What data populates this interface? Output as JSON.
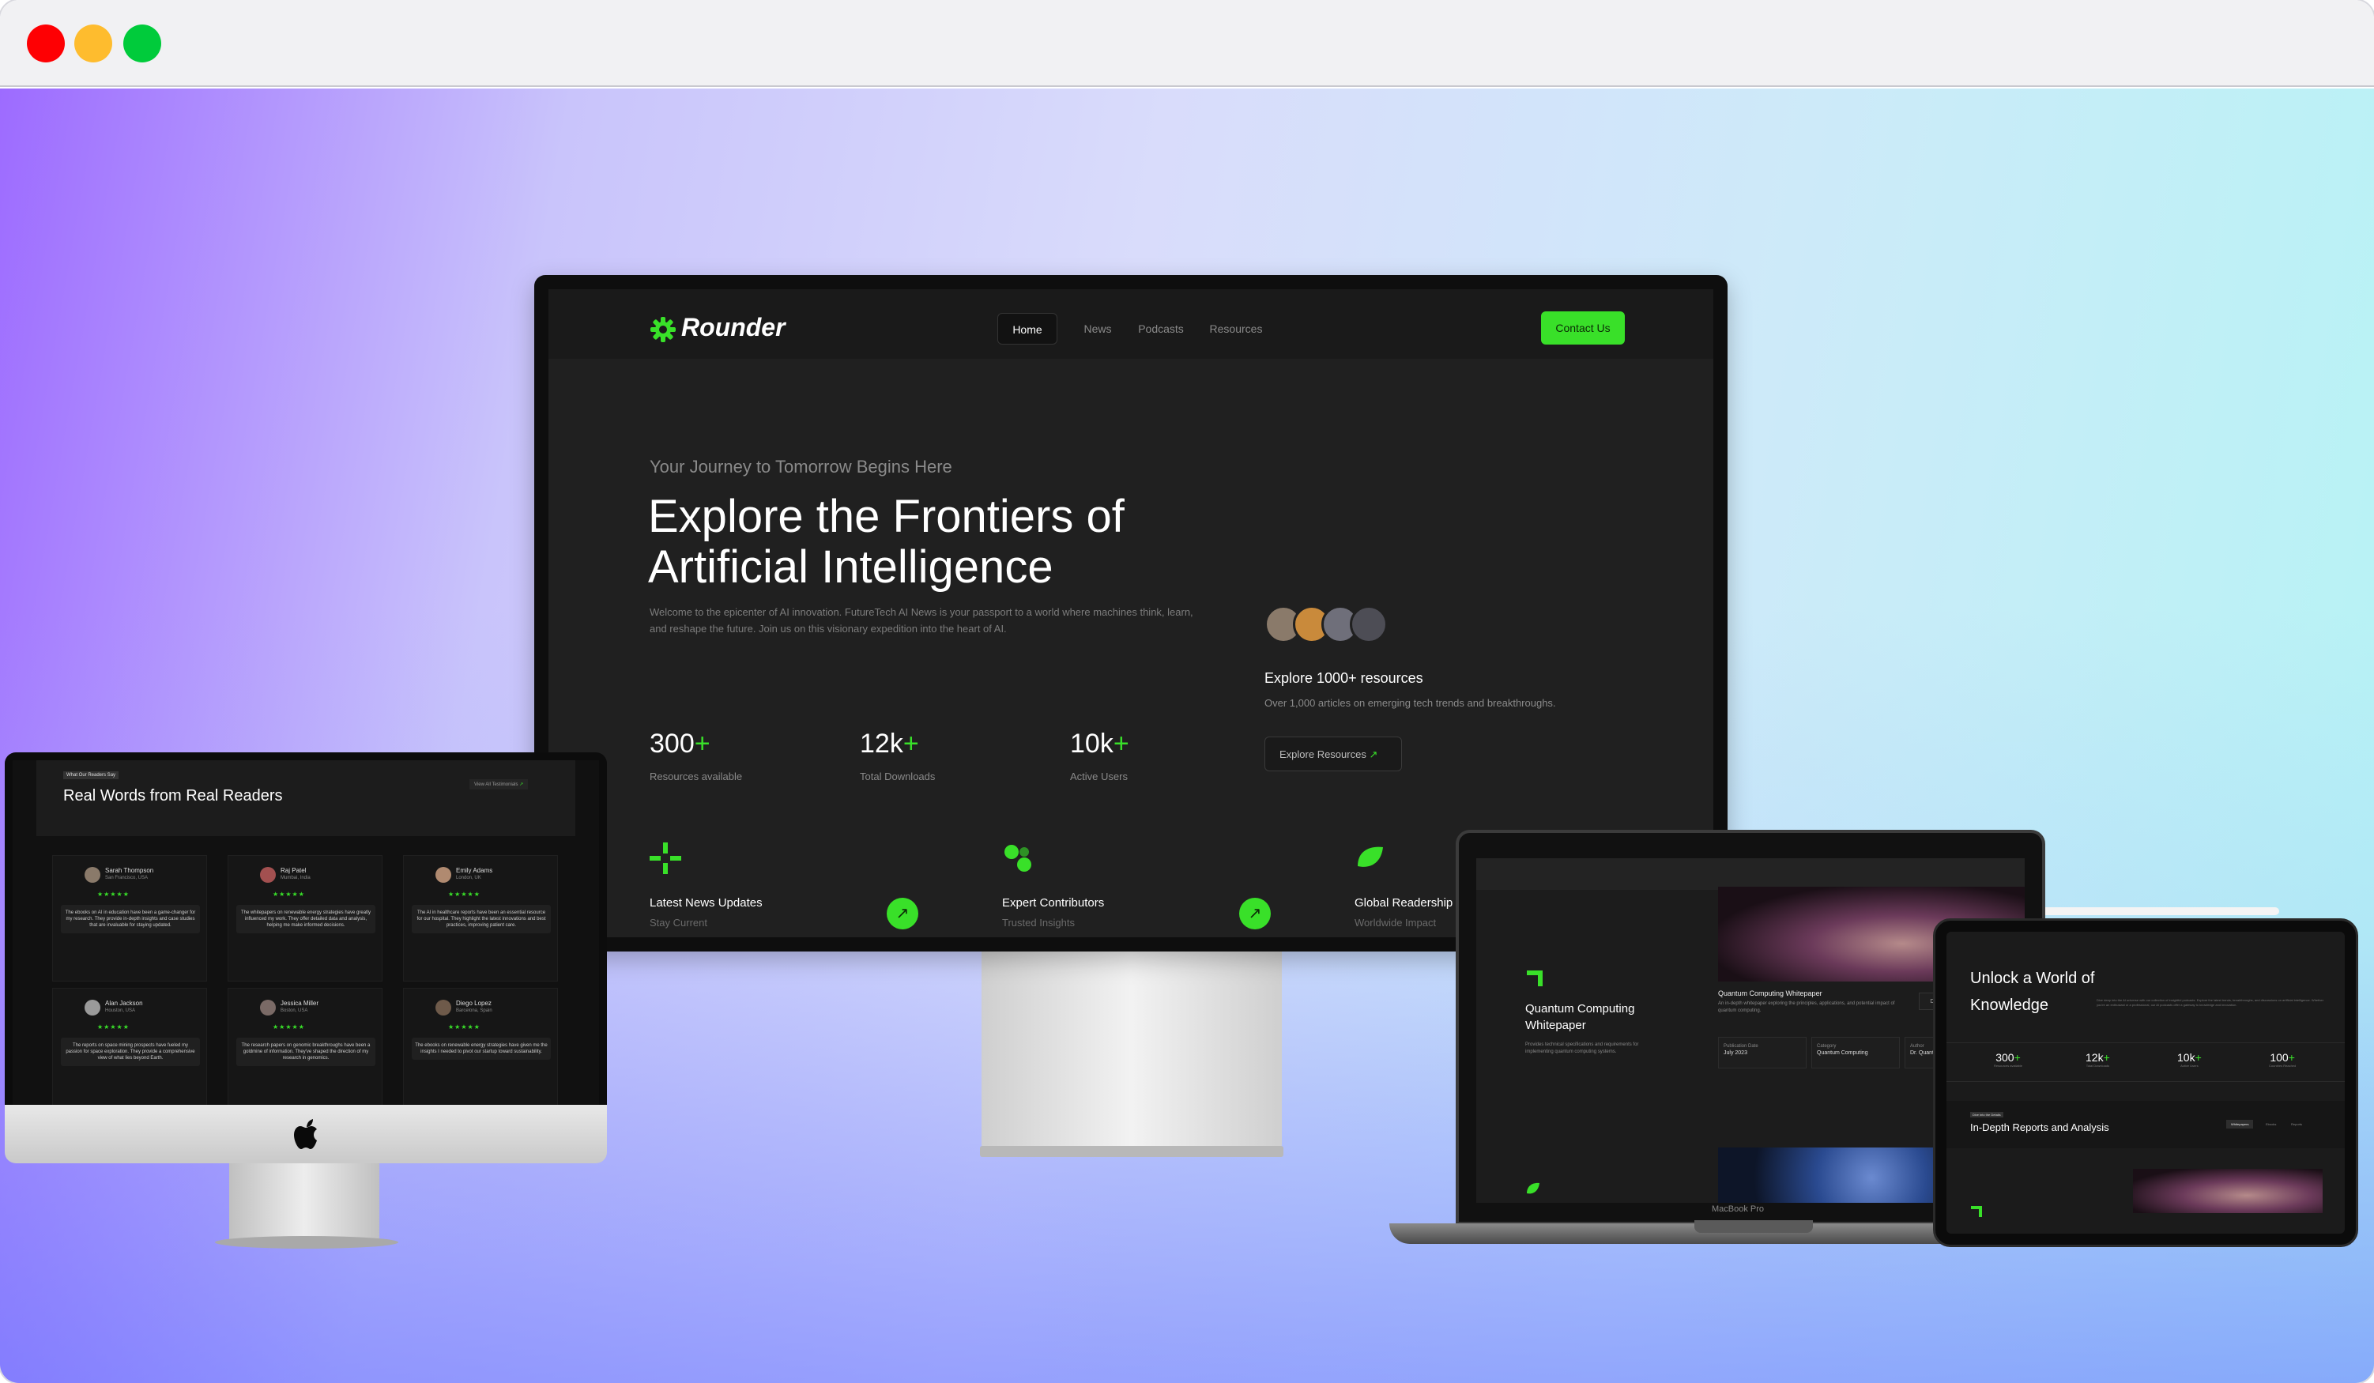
{
  "window": {
    "controls": [
      "close",
      "minimize",
      "maximize"
    ],
    "colors": {
      "close": "#fe0003",
      "minimize": "#febc2e",
      "maximize": "#00cb3b"
    }
  },
  "monitor": {
    "brand": "Rounder",
    "nav": [
      "Home",
      "News",
      "Podcasts",
      "Resources"
    ],
    "contact": "Contact Us",
    "tagline": "Your Journey to Tomorrow Begins Here",
    "hero_line1": "Explore the Frontiers of",
    "hero_line2": "Artificial Intelligence",
    "hero_desc": "Welcome to the epicenter of AI innovation. FutureTech AI News is your passport to a world where machines think, learn, and reshape the future. Join us on this visionary expedition into the heart of AI.",
    "stats": [
      {
        "num": "300",
        "plus": "+",
        "label": "Resources available"
      },
      {
        "num": "12k",
        "plus": "+",
        "label": "Total Downloads"
      },
      {
        "num": "10k",
        "plus": "+",
        "label": "Active Users"
      }
    ],
    "explore_title": "Explore 1000+ resources",
    "explore_desc": "Over 1,000 articles on emerging tech trends and breakthroughs.",
    "explore_btn": "Explore Resources",
    "features": [
      {
        "title": "Latest News Updates",
        "sub": "Stay Current"
      },
      {
        "title": "Expert Contributors",
        "sub": "Trusted Insights"
      },
      {
        "title": "Global Readership",
        "sub": "Worldwide Impact"
      }
    ],
    "accent": "#39e029"
  },
  "imac": {
    "badge": "What Our Readers Say",
    "title": "Real Words from Real Readers",
    "view_all": "View All Testimonials",
    "reviews": [
      {
        "name": "Sarah Thompson",
        "loc": "San Francisco, USA",
        "stars": "★★★★★",
        "text": "The ebooks on AI in education have been a game-changer for my research. They provide in-depth insights and case studies that are invaluable for staying updated."
      },
      {
        "name": "Raj Patel",
        "loc": "Mumbai, India",
        "stars": "★★★★★",
        "text": "The whitepapers on renewable energy strategies have greatly influenced my work. They offer detailed data and analysis, helping me make informed decisions."
      },
      {
        "name": "Emily Adams",
        "loc": "London, UK",
        "stars": "★★★★★",
        "text": "The AI in healthcare reports have been an essential resource for our hospital. They highlight the latest innovations and best practices, improving patient care."
      },
      {
        "name": "Alan Jackson",
        "loc": "Houston, USA",
        "stars": "★★★★★",
        "text": "The reports on space mining prospects have fueled my passion for space exploration. They provide a comprehensive view of what lies beyond Earth."
      },
      {
        "name": "Jessica Miller",
        "loc": "Boston, USA",
        "stars": "★★★★★",
        "text": "The research papers on genomic breakthroughs have been a goldmine of information. They've shaped the direction of my research in genomics."
      },
      {
        "name": "Diego Lopez",
        "loc": "Barcelona, Spain",
        "stars": "★★★★★",
        "text": "The ebooks on renewable energy strategies have given me the insights I needed to pivot our startup toward sustainability."
      }
    ]
  },
  "macbook": {
    "card_title": "Quantum Computing Whitepaper",
    "card_desc": "Provides technical specifications and requirements for implementing quantum computing systems.",
    "item_title": "Quantum Computing Whitepaper",
    "item_desc": "An in-depth whitepaper exploring the principles, applications, and potential impact of quantum computing.",
    "meta": [
      {
        "label": "Publication Date",
        "value": "July 2023"
      },
      {
        "label": "Category",
        "value": "Quantum Computing"
      },
      {
        "label": "Author",
        "value": "Dr. Quantum"
      }
    ],
    "download": "Download",
    "model": "MacBook Pro"
  },
  "ipad": {
    "title_line1": "Unlock a World of",
    "title_line2": "Knowledge",
    "desc": "Dive deep into the AI universe with our collection of insightful podcasts. Explore the latest trends, breakthroughs, and discussions on artificial intelligence. Whether you're an enthusiast or a professional, our AI podcasts offer a gateway to knowledge and innovation.",
    "stats": [
      {
        "num": "300",
        "plus": "+",
        "label": "Resources available"
      },
      {
        "num": "12k",
        "plus": "+",
        "label": "Total Downloads"
      },
      {
        "num": "10k",
        "plus": "+",
        "label": "Active Users"
      },
      {
        "num": "100",
        "plus": "+",
        "label": "Countries Reached"
      }
    ],
    "badge": "Dive into the Details",
    "section_title": "In-Depth Reports and Analysis",
    "tabs": [
      "Whitepapers",
      "Ebooks",
      "Reports"
    ]
  }
}
